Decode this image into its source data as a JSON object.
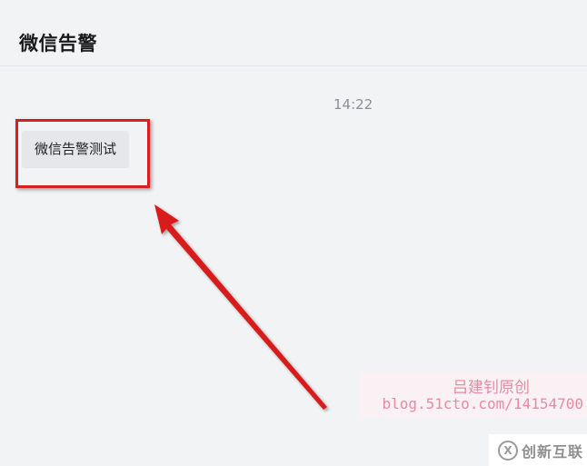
{
  "header": {
    "title": "微信告警"
  },
  "chat": {
    "timestamp": "14:22",
    "messages": [
      {
        "text": "微信告警测试"
      }
    ]
  },
  "annotation": {
    "color": "#d81e1e"
  },
  "watermark": {
    "line1": "吕建钊原创",
    "line2": "blog.51cto.com/14154700"
  },
  "corner_logo": {
    "icon": "brand-logo-icon",
    "text": "创新互联"
  }
}
